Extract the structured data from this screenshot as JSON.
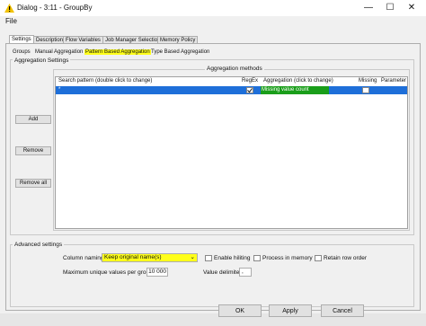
{
  "window": {
    "title": "Dialog - 3:11 - GroupBy",
    "controls": [
      "—",
      "☐",
      "✕"
    ]
  },
  "menu": {
    "file": "File"
  },
  "tabs": [
    "Settings",
    "Description",
    "Flow Variables",
    "Job Manager Selection",
    "Memory Policy"
  ],
  "aggregation_settings": {
    "title": "Aggregation Settings",
    "subtabs": [
      "Groups",
      "Manual Aggregation",
      "Pattern Based Aggregation",
      "Type Based Aggregation"
    ],
    "buttons": {
      "add": "Add",
      "remove": "Remove",
      "remove_all": "Remove all"
    },
    "methods_title": "Aggregation methods",
    "columns": [
      "Search pattern (double click to change)",
      "RegEx",
      "Aggregation (click to change)",
      "Missing",
      "Parameter"
    ],
    "rows": [
      {
        "pattern": "*",
        "regex": true,
        "aggregation": "Missing value count",
        "missing": false,
        "parameter": ""
      }
    ]
  },
  "advanced": {
    "title": "Advanced settings",
    "column_naming_label": "Column naming:",
    "column_naming_value": "Keep original name(s)",
    "enable_hiliting": "Enable hiliting",
    "process_in_memory": "Process in memory",
    "retain_row_order": "Retain row order",
    "max_unique_label": "Maximum unique values per group",
    "max_unique_value": "10 000",
    "value_delimiter_label": "Value delimiter",
    "value_delimiter_value": ","
  },
  "dialog_buttons": {
    "ok": "OK",
    "apply": "Apply",
    "cancel": "Cancel"
  },
  "highlight_color": "#ffff1a",
  "selection_color": "#1e6fd9",
  "aggregation_cell_color": "#1a9e1a"
}
